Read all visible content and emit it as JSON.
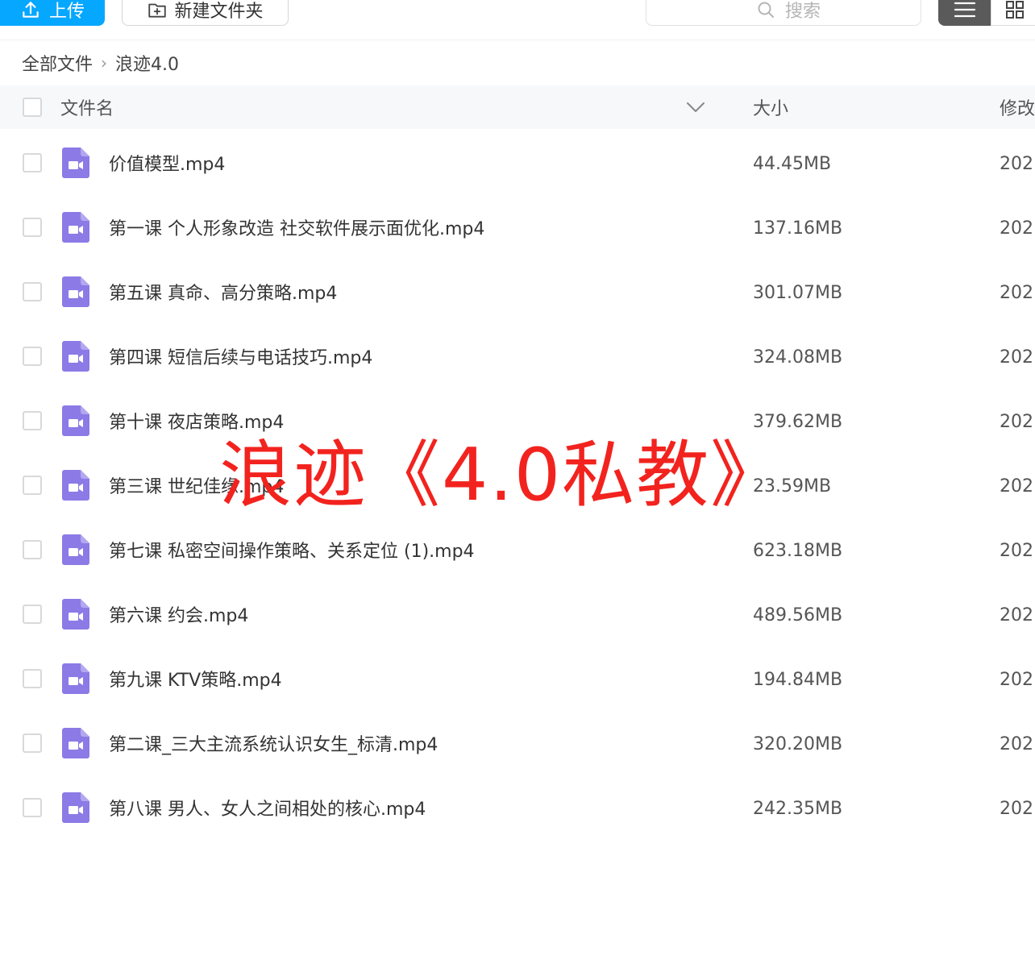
{
  "toolbar": {
    "upload_label": "上传",
    "new_folder_label": "新建文件夹",
    "search_placeholder": "搜索"
  },
  "breadcrumb": {
    "root": "全部文件",
    "current": "浪迹4.0"
  },
  "table": {
    "columns": {
      "name": "文件名",
      "size": "大小",
      "modified": "修改"
    },
    "rows": [
      {
        "name": "价值模型.mp4",
        "size": "44.45MB",
        "date": "202"
      },
      {
        "name": "第一课 个人形象改造 社交软件展示面优化.mp4",
        "size": "137.16MB",
        "date": "202"
      },
      {
        "name": "第五课 真命、高分策略.mp4",
        "size": "301.07MB",
        "date": "202"
      },
      {
        "name": "第四课 短信后续与电话技巧.mp4",
        "size": "324.08MB",
        "date": "202"
      },
      {
        "name": "第十课 夜店策略.mp4",
        "size": "379.62MB",
        "date": "202"
      },
      {
        "name": "第三课 世纪佳缘.mp4",
        "size": "23.59MB",
        "date": "202"
      },
      {
        "name": "第七课 私密空间操作策略、关系定位 (1).mp4",
        "size": "623.18MB",
        "date": "202"
      },
      {
        "name": "第六课 约会.mp4",
        "size": "489.56MB",
        "date": "202"
      },
      {
        "name": "第九课 KTV策略.mp4",
        "size": "194.84MB",
        "date": "202"
      },
      {
        "name": "第二课_三大主流系统认识女生_标清.mp4",
        "size": "320.20MB",
        "date": "202"
      },
      {
        "name": "第八课 男人、女人之间相处的核心.mp4",
        "size": "242.35MB",
        "date": "202"
      }
    ]
  },
  "watermark": "浪迹《4.0私教》",
  "colors": {
    "accent": "#06a7ff",
    "video_icon": "#8c7ae6",
    "watermark": "#f2231e"
  },
  "icons": {
    "upload": "upload-icon",
    "new_folder": "folder-plus-icon",
    "search": "search-icon",
    "list_view": "list-view-icon",
    "grid_view": "grid-view-icon",
    "sort": "chevron-down-icon",
    "file": "video-file-icon"
  }
}
